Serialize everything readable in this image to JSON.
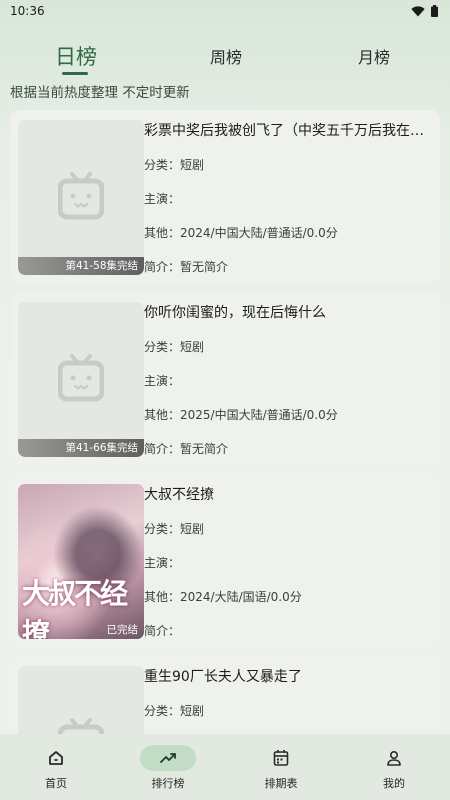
{
  "status_bar": {
    "time": "10:36"
  },
  "tabs": [
    {
      "label": "日榜",
      "active": true
    },
    {
      "label": "周榜",
      "active": false
    },
    {
      "label": "月榜",
      "active": false
    }
  ],
  "subtitle": "根据当前热度整理 不定时更新",
  "items": [
    {
      "title": "彩票中奖后我被创飞了（中奖五千万后我在…",
      "category": "分类：短剧",
      "cast": "主演：",
      "other": "其他：2024/中国大陆/普通话/0.0分",
      "intro": "简介：暂无简介",
      "badge": "第41-58集完结",
      "poster": "placeholder-tv-icon"
    },
    {
      "title": "你听你闺蜜的，现在后悔什么",
      "category": "分类：短剧",
      "cast": "主演：",
      "other": "其他：2025/中国大陆/普通话/0.0分",
      "intro": "简介：暂无简介",
      "badge": "第41-66集完结",
      "poster": "placeholder-tv-icon"
    },
    {
      "title": "大叔不经撩",
      "category": "分类：短剧",
      "cast": "主演：",
      "other": "其他：2024/大陆/国语/0.0分",
      "intro": "简介：",
      "badge": "已完结",
      "poster_title": "大叔不经撩",
      "poster": "drama-poster-image"
    },
    {
      "title": "重生90厂长夫人又暴走了",
      "category": "分类：短剧",
      "poster": "placeholder-tv-icon"
    }
  ],
  "bottom_nav": [
    {
      "label": "首页",
      "icon": "home-icon",
      "active": false
    },
    {
      "label": "排行榜",
      "icon": "trending-up-icon",
      "active": true
    },
    {
      "label": "排期表",
      "icon": "calendar-icon",
      "active": false
    },
    {
      "label": "我的",
      "icon": "person-icon",
      "active": false
    }
  ],
  "colors": {
    "accent": "#2e6b43",
    "active_pill": "#c3dcc6",
    "background": "#e9efe8"
  }
}
